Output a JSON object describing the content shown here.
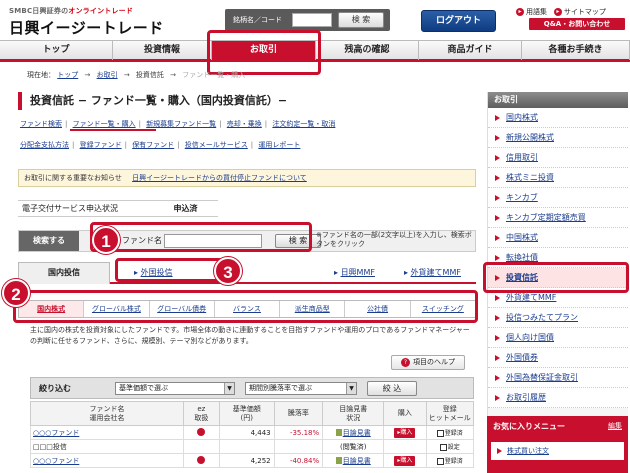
{
  "header": {
    "brand_small": "SMBC日興証券の",
    "brand_small_accent": "オンライントレード",
    "brand_large": "日興イージートレード",
    "search_label": "銘柄名／コード",
    "search_button": "検 索",
    "logout_button": "ログアウト",
    "glossary_link": "用語集",
    "sitemap_link": "サイトマップ",
    "qa_button": "Q&A・お問い合わせ"
  },
  "main_nav": [
    {
      "label": "トップ",
      "active": false
    },
    {
      "label": "投資情報",
      "active": false
    },
    {
      "label": "お取引",
      "active": true
    },
    {
      "label": "残高の確認",
      "active": false
    },
    {
      "label": "商品ガイド",
      "active": false
    },
    {
      "label": "各種お手続き",
      "active": false
    }
  ],
  "breadcrumb": {
    "prefix": "現在地：",
    "items": [
      "トップ",
      "お取引",
      "投資信託",
      "ファンド一覧・購入"
    ],
    "sep": "→"
  },
  "page_title": "投資信託 − ファンド一覧・購入（国内投資信託）−",
  "subnav1": [
    "ファンド検索",
    "ファンド一覧・購入",
    "新規募集ファンド一覧",
    "売却・乗換",
    "注文約定一覧・取消"
  ],
  "subnav2": [
    "分配金支払方法",
    "登録ファンド",
    "保有ファンド",
    "投信メールサービス",
    "運用レポート"
  ],
  "notice": {
    "label": "お取引に関する重要なお知らせ",
    "link": "日興イージートレードからの買付停止ファンドについて"
  },
  "status": {
    "label": "電子交付サービス申込状況",
    "value": "申込済"
  },
  "search_panel": {
    "label": "検索する",
    "fund_label": "ファンド名",
    "button": "検 索",
    "hint": "※ファンド名の一部(2文字以上)を入力し、検索ボタンをクリック"
  },
  "tabs": {
    "domestic": "国内投信",
    "foreign": "外国投信",
    "nikko_mmf": "日興MMF",
    "foreign_mmf": "外貨建てMMF"
  },
  "categories": [
    {
      "label": "国内株式",
      "active": true
    },
    {
      "label": "グローバル株式",
      "active": false
    },
    {
      "label": "グローバル債券",
      "active": false
    },
    {
      "label": "バランス",
      "active": false
    },
    {
      "label": "派生商品型",
      "active": false
    },
    {
      "label": "公社債",
      "active": false
    },
    {
      "label": "スイッチング",
      "active": false
    }
  ],
  "description": "主に国内の株式を投資対象にしたファンドです。市場全体の動きに連動することを目指すファンドや運用のプロであるファンドマネージャーの判断に任せるファンド、さらに、規模別、テーマ別などがあります。",
  "help_button": "項目のヘルプ",
  "filter": {
    "label": "絞り込む",
    "select1": "基準価額で選ぶ",
    "select2": "期間別騰落率で選ぶ",
    "button": "絞 込"
  },
  "table": {
    "headers": [
      "ファンド名\n運用会社名",
      "ez\n取扱",
      "基準価額\n(円)",
      "騰落率",
      "目論見書\n状況",
      "購入",
      "登録\nヒットメール"
    ],
    "rows": [
      {
        "name": "○○○ファンド",
        "company": "□□□投信",
        "price": "4,443",
        "change": "-35.18%",
        "doc": "目論見書",
        "doc_status": "(閲覧済)",
        "buy": "▸購入",
        "reg": "登録済",
        "reg2": "設定"
      },
      {
        "name": "○○○ファンド",
        "company": "",
        "price": "4,252",
        "change": "-40.84%",
        "doc": "目論見書",
        "doc_status": "",
        "buy": "▸購入",
        "reg": "登録済",
        "reg2": ""
      }
    ]
  },
  "sidebar": {
    "title": "お取引",
    "items": [
      {
        "label": "国内株式",
        "active": false
      },
      {
        "label": "新規公開株式",
        "active": false
      },
      {
        "label": "信用取引",
        "active": false
      },
      {
        "label": "株式ミニ投資",
        "active": false
      },
      {
        "label": "キンカブ",
        "active": false
      },
      {
        "label": "キンカブ定期定額売買",
        "active": false
      },
      {
        "label": "中国株式",
        "active": false
      },
      {
        "label": "転換社債",
        "active": false
      },
      {
        "label": "投資信託",
        "active": true
      },
      {
        "label": "外貨建てMMF",
        "active": false
      },
      {
        "label": "投信つみたてプラン",
        "active": false
      },
      {
        "label": "個人向け国債",
        "active": false
      },
      {
        "label": "外国債券",
        "active": false
      },
      {
        "label": "外国為替保証金取引",
        "active": false
      },
      {
        "label": "お取引履歴",
        "active": false
      }
    ],
    "fav_title": "お気に入りメニュー",
    "fav_edit": "編集",
    "fav_item": "株式買い注文"
  },
  "markers": [
    "1",
    "2",
    "3"
  ],
  "colors": {
    "accent": "#c8102e",
    "link": "#1a3d8f",
    "logout": "#0f3c82"
  }
}
